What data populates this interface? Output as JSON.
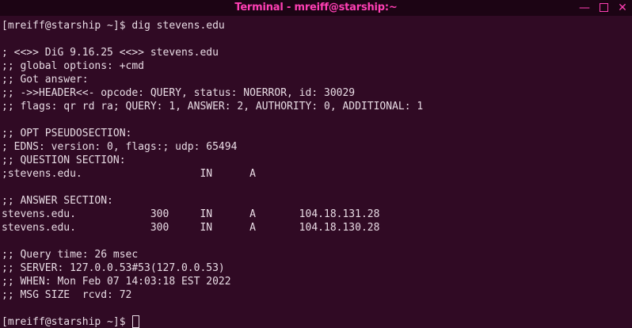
{
  "window": {
    "title": "Terminal - mreiff@starship:~",
    "minimize_glyph": "—",
    "close_glyph": "✕"
  },
  "terminal": {
    "lines": [
      "[mreiff@starship ~]$ dig stevens.edu",
      "",
      "; <<>> DiG 9.16.25 <<>> stevens.edu",
      ";; global options: +cmd",
      ";; Got answer:",
      ";; ->>HEADER<<- opcode: QUERY, status: NOERROR, id: 30029",
      ";; flags: qr rd ra; QUERY: 1, ANSWER: 2, AUTHORITY: 0, ADDITIONAL: 1",
      "",
      ";; OPT PSEUDOSECTION:",
      "; EDNS: version: 0, flags:; udp: 65494",
      ";; QUESTION SECTION:",
      ";stevens.edu.                   IN      A",
      "",
      ";; ANSWER SECTION:",
      "stevens.edu.            300     IN      A       104.18.131.28",
      "stevens.edu.            300     IN      A       104.18.130.28",
      "",
      ";; Query time: 26 msec",
      ";; SERVER: 127.0.0.53#53(127.0.0.53)",
      ";; WHEN: Mon Feb 07 14:03:18 EST 2022",
      ";; MSG SIZE  rcvd: 72",
      "",
      "[mreiff@starship ~]$ "
    ]
  },
  "colors": {
    "background": "#300a24",
    "titlebar": "#1c0414",
    "accent": "#ff3fb4",
    "text": "#e8dbe4"
  }
}
